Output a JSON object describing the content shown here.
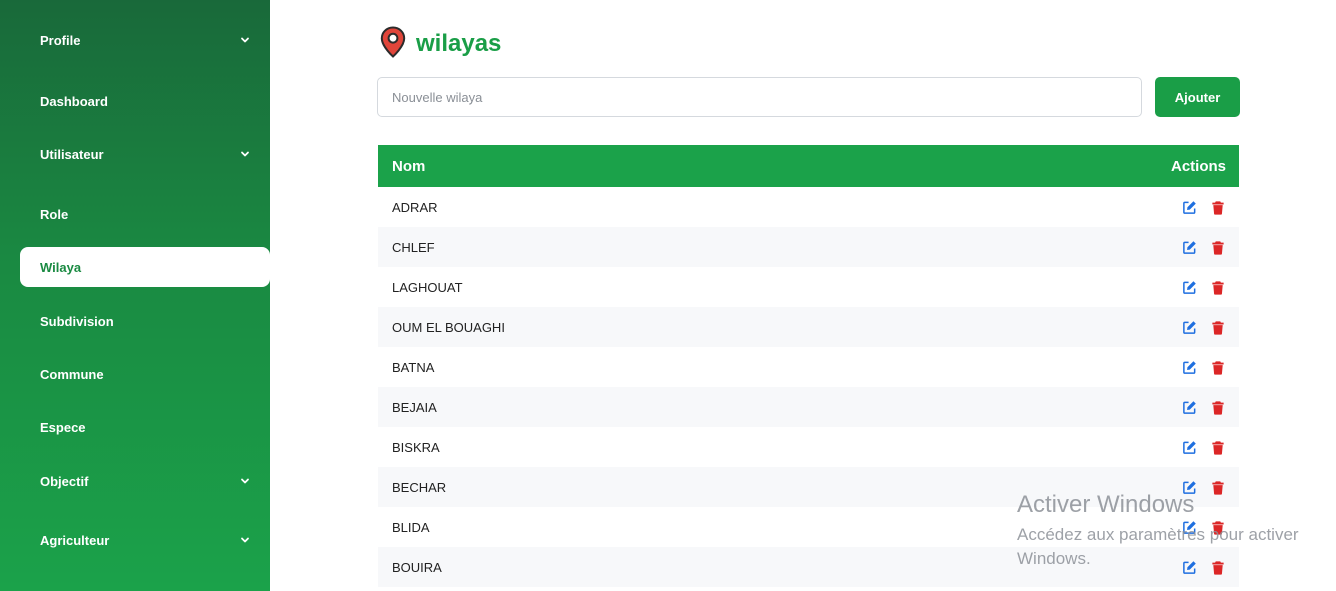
{
  "sidebar": {
    "items": [
      {
        "label": "Profile",
        "chevron": true
      },
      {
        "label": "Dashboard",
        "chevron": false
      },
      {
        "label": "Utilisateur",
        "chevron": true
      },
      {
        "label": "Role",
        "chevron": false
      },
      {
        "label": "Wilaya",
        "chevron": false,
        "active": true
      },
      {
        "label": "Subdivision",
        "chevron": false
      },
      {
        "label": "Commune",
        "chevron": false
      },
      {
        "label": "Espece",
        "chevron": false
      },
      {
        "label": "Objectif",
        "chevron": true
      },
      {
        "label": "Agriculteur",
        "chevron": true
      }
    ]
  },
  "main": {
    "title": "wilayas",
    "title_icon": "map-pin-icon",
    "new_input": {
      "placeholder": "Nouvelle wilaya",
      "value": ""
    },
    "add_label": "Ajouter",
    "table": {
      "headers": {
        "name": "Nom",
        "actions": "Actions"
      },
      "rows": [
        "ADRAR",
        "CHLEF",
        "LAGHOUAT",
        "OUM EL BOUAGHI",
        "BATNA",
        "BEJAIA",
        "BISKRA",
        "BECHAR",
        "BLIDA",
        "BOUIRA"
      ]
    }
  },
  "watermark": {
    "title": "Activer Windows",
    "subtitle": "Accédez aux paramètres pour activer Windows."
  },
  "colors": {
    "brand": "#1a9e47",
    "edit": "#1f6fe0",
    "delete": "#dc2626",
    "pin": "#e0453a"
  }
}
